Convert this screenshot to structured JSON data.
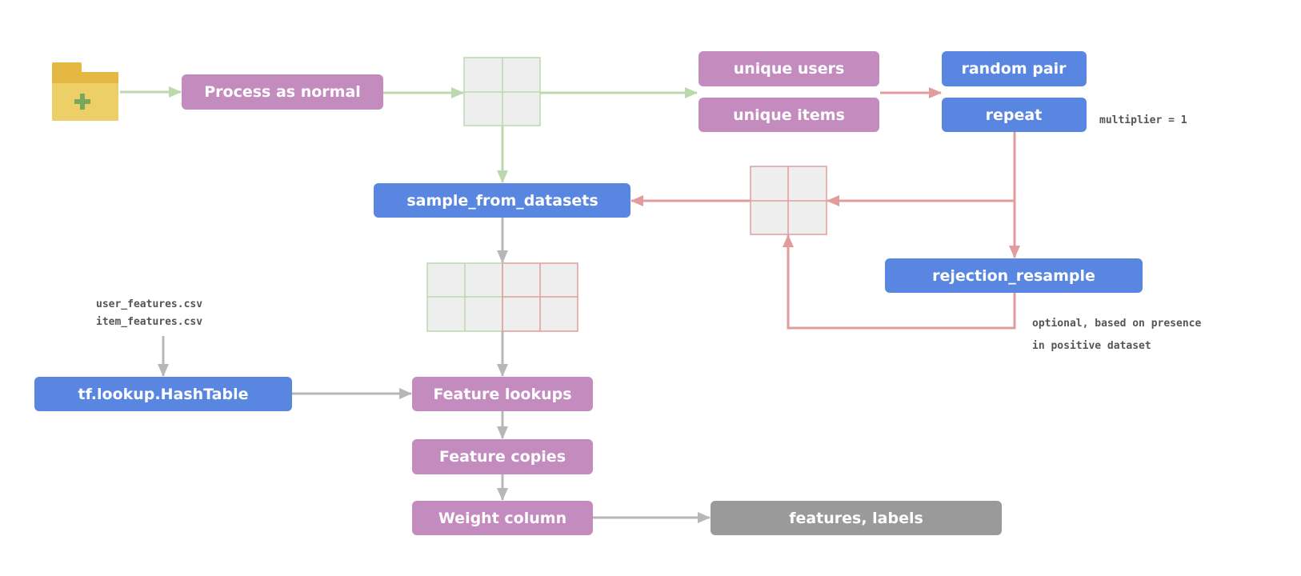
{
  "colors": {
    "purple": "#c48bbf",
    "blue": "#5886e0",
    "gray_box": "#9a9a9a",
    "green_line": "#bcd8ad",
    "red_line": "#e09d9b",
    "gray_line": "#b7b7b7",
    "folder": "#ecd067"
  },
  "icons": {
    "folder": "folder-add-icon"
  },
  "nodes": {
    "process": "Process as normal",
    "unique_users": "unique users",
    "unique_items": "unique items",
    "random_pair": "random pair",
    "repeat": "repeat",
    "sample_from_datasets": "sample_from_datasets",
    "rejection_resample": "rejection_resample",
    "hashtable": "tf.lookup.HashTable",
    "feature_lookups": "Feature lookups",
    "feature_copies": "Feature copies",
    "weight_column": "Weight column",
    "features_labels": "features, labels"
  },
  "annotations": {
    "multiplier": "multiplier = 1",
    "optional_line1": "optional, based on presence",
    "optional_line2": "in positive dataset",
    "user_features": "user_features.csv",
    "item_features": "item_features.csv"
  }
}
